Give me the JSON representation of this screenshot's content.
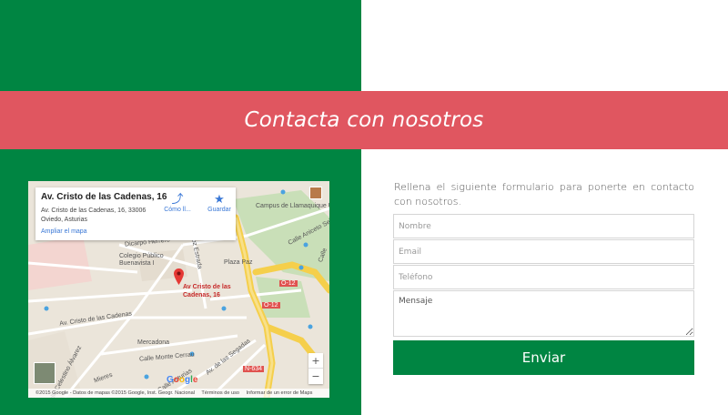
{
  "banner": {
    "title": "Contacta con nosotros"
  },
  "colors": {
    "green": "#008542",
    "banner": "#e05660",
    "white": "#ffffff",
    "link": "#3a78d6"
  },
  "map": {
    "card": {
      "place_name": "Av. Cristo de las Cadenas, 16",
      "address": "Av. Cristo de las Cadenas, 16, 33006 Oviedo, Asturias",
      "directions_label": "Cómo ll...",
      "save_label": "Guardar",
      "enlarge_label": "Ampliar el mapa",
      "directions_icon": "directions-icon",
      "save_icon": "star-icon"
    },
    "marker_label": "Av Cristo de las Cadenas, 16",
    "street_labels": {
      "campus": "Campus de Llamaquique UO",
      "calle_aniceto": "Calle Aniceto Sela",
      "calle_vertical": "Calle",
      "dicarpo": "Dicarpo Herrero",
      "estrada": "Muñoz Estrada",
      "colegio": "Colegio Público Buenavista I",
      "plaza_paz": "Plaza Paz",
      "av_cristo": "Av. Cristo de las Cadenas",
      "mercadona": "Mercadona",
      "monte_cerrau": "Calle Monte Cerrau",
      "celestino": "Calle Celestino Álvarez",
      "mieres": "Mieres",
      "segadas": "Av. de las Segadas",
      "calle_s": "Calle Asturias",
      "n634": "N-634",
      "o12a": "O-12",
      "o12b": "O-12"
    },
    "zoom_in": "+",
    "zoom_out": "−",
    "google_logo": "Google",
    "attribution": {
      "copyright": "©2015 Google - Datos de mapas ©2015 Google, Inst. Geogr. Nacional",
      "terms": "Términos de uso",
      "report": "Informar de un error de Maps"
    }
  },
  "form": {
    "intro": "Rellena el siguiente formulario para ponerte en contacto con nosotros.",
    "name_placeholder": "Nombre",
    "email_placeholder": "Email",
    "phone_placeholder": "Teléfono",
    "message_placeholder": "Mensaje",
    "submit_label": "Enviar"
  }
}
